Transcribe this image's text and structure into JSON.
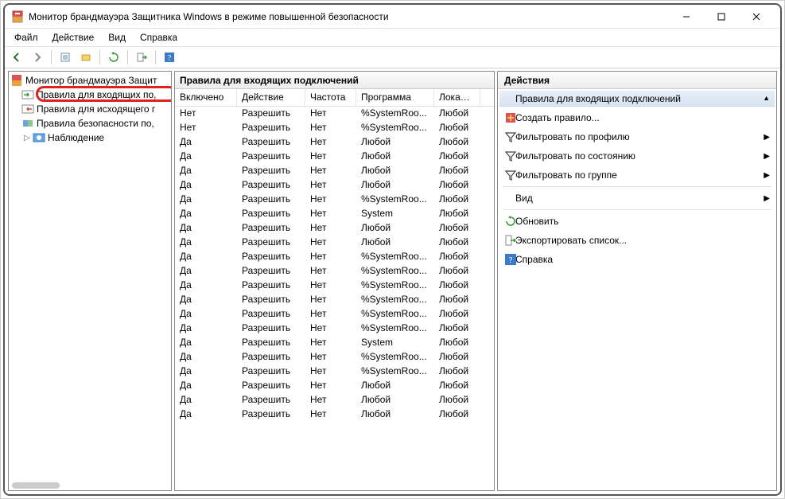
{
  "window": {
    "title": "Монитор брандмауэра Защитника Windows в режиме повышенной безопасности"
  },
  "menubar": {
    "file": "Файл",
    "action": "Действие",
    "view": "Вид",
    "help": "Справка"
  },
  "tree": {
    "root": "Монитор брандмауэра Защит",
    "inbound": "Правила для входящих по,",
    "outbound": "Правила для исходящего г",
    "security": "Правила безопасности по,",
    "monitoring": "Наблюдение"
  },
  "list": {
    "title": "Правила для входящих подключений",
    "columns": [
      "Включено",
      "Действие",
      "Частота",
      "Программа",
      "Локальн"
    ],
    "rows": [
      {
        "c0": "Нет",
        "c1": "Разрешить",
        "c2": "Нет",
        "c3": "%SystemRoo...",
        "c4": "Любой"
      },
      {
        "c0": "Нет",
        "c1": "Разрешить",
        "c2": "Нет",
        "c3": "%SystemRoo...",
        "c4": "Любой"
      },
      {
        "c0": "Да",
        "c1": "Разрешить",
        "c2": "Нет",
        "c3": "Любой",
        "c4": "Любой"
      },
      {
        "c0": "Да",
        "c1": "Разрешить",
        "c2": "Нет",
        "c3": "Любой",
        "c4": "Любой"
      },
      {
        "c0": "Да",
        "c1": "Разрешить",
        "c2": "Нет",
        "c3": "Любой",
        "c4": "Любой"
      },
      {
        "c0": "Да",
        "c1": "Разрешить",
        "c2": "Нет",
        "c3": "Любой",
        "c4": "Любой"
      },
      {
        "c0": "Да",
        "c1": "Разрешить",
        "c2": "Нет",
        "c3": "%SystemRoo...",
        "c4": "Любой"
      },
      {
        "c0": "Да",
        "c1": "Разрешить",
        "c2": "Нет",
        "c3": "System",
        "c4": "Любой"
      },
      {
        "c0": "Да",
        "c1": "Разрешить",
        "c2": "Нет",
        "c3": "Любой",
        "c4": "Любой"
      },
      {
        "c0": "Да",
        "c1": "Разрешить",
        "c2": "Нет",
        "c3": "Любой",
        "c4": "Любой"
      },
      {
        "c0": "Да",
        "c1": "Разрешить",
        "c2": "Нет",
        "c3": "%SystemRoo...",
        "c4": "Любой"
      },
      {
        "c0": "Да",
        "c1": "Разрешить",
        "c2": "Нет",
        "c3": "%SystemRoo...",
        "c4": "Любой"
      },
      {
        "c0": "Да",
        "c1": "Разрешить",
        "c2": "Нет",
        "c3": "%SystemRoo...",
        "c4": "Любой"
      },
      {
        "c0": "Да",
        "c1": "Разрешить",
        "c2": "Нет",
        "c3": "%SystemRoo...",
        "c4": "Любой"
      },
      {
        "c0": "Да",
        "c1": "Разрешить",
        "c2": "Нет",
        "c3": "%SystemRoo...",
        "c4": "Любой"
      },
      {
        "c0": "Да",
        "c1": "Разрешить",
        "c2": "Нет",
        "c3": "%SystemRoo...",
        "c4": "Любой"
      },
      {
        "c0": "Да",
        "c1": "Разрешить",
        "c2": "Нет",
        "c3": "System",
        "c4": "Любой"
      },
      {
        "c0": "Да",
        "c1": "Разрешить",
        "c2": "Нет",
        "c3": "%SystemRoo...",
        "c4": "Любой"
      },
      {
        "c0": "Да",
        "c1": "Разрешить",
        "c2": "Нет",
        "c3": "%SystemRoo...",
        "c4": "Любой"
      },
      {
        "c0": "Да",
        "c1": "Разрешить",
        "c2": "Нет",
        "c3": "Любой",
        "c4": "Любой"
      },
      {
        "c0": "Да",
        "c1": "Разрешить",
        "c2": "Нет",
        "c3": "Любой",
        "c4": "Любой"
      },
      {
        "c0": "Да",
        "c1": "Разрешить",
        "c2": "Нет",
        "c3": "Любой",
        "c4": "Любой"
      }
    ]
  },
  "actions": {
    "title": "Действия",
    "section": "Правила для входящих подключений",
    "items": {
      "new_rule": "Создать правило...",
      "filter_profile": "Фильтровать по профилю",
      "filter_state": "Фильтровать по состоянию",
      "filter_group": "Фильтровать по группе",
      "view": "Вид",
      "refresh": "Обновить",
      "export": "Экспортировать список...",
      "help": "Справка"
    }
  }
}
